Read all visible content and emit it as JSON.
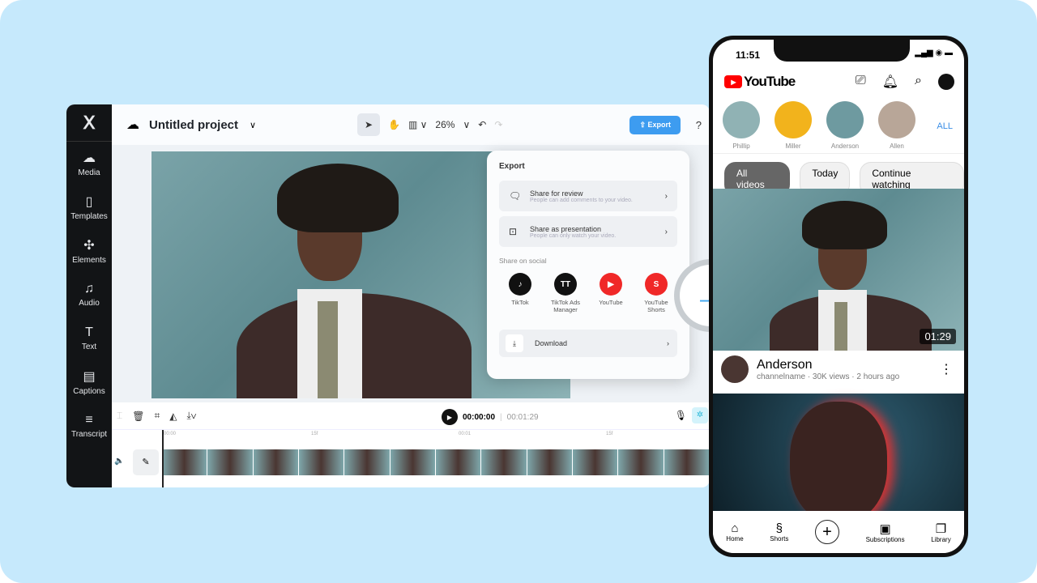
{
  "editor": {
    "sidebar": [
      {
        "icon": "cloud-upload-icon",
        "glyph": "☁",
        "label": "Media"
      },
      {
        "icon": "templates-icon",
        "glyph": "▯",
        "label": "Templates"
      },
      {
        "icon": "elements-icon",
        "glyph": "✣",
        "label": "Elements"
      },
      {
        "icon": "music-icon",
        "glyph": "♫",
        "label": "Audio"
      },
      {
        "icon": "text-icon",
        "glyph": "T",
        "label": "Text"
      },
      {
        "icon": "captions-icon",
        "glyph": "▤",
        "label": "Captions"
      },
      {
        "icon": "transcript-icon",
        "glyph": "≡",
        "label": "Transcript"
      }
    ],
    "title": "Untitled project",
    "zoom": "26%",
    "export_label": "Export",
    "export_panel": {
      "title": "Export",
      "options": [
        {
          "title": "Share for review",
          "desc": "People can add comments to your video."
        },
        {
          "title": "Share as presentation",
          "desc": "People can only watch your video."
        }
      ],
      "social_title": "Share on social",
      "social": [
        {
          "label": "TikTok",
          "color": "#111111",
          "glyph": "♪"
        },
        {
          "label": "TikTok Ads Manager",
          "color": "#111111",
          "glyph": "TT"
        },
        {
          "label": "YouTube",
          "color": "#f02828",
          "glyph": "▶"
        },
        {
          "label": "YouTube Shorts",
          "color": "#f02828",
          "glyph": "S"
        }
      ],
      "download": "Download"
    },
    "timeline": {
      "current": "00:00:00",
      "total": "00:01:29",
      "ticks": [
        "00:00",
        "15f",
        "00:01",
        "15f"
      ]
    }
  },
  "phone": {
    "time": "11:51",
    "status": "▂▄▆ ◉ ▬",
    "logo": "YouTube",
    "subscriptions": [
      {
        "name": "Phillip",
        "color": "#90b2b4"
      },
      {
        "name": "Miller",
        "color": "#f2b31c"
      },
      {
        "name": "Anderson",
        "color": "#6e9aa0"
      },
      {
        "name": "Allen",
        "color": "#b8a698"
      }
    ],
    "all": "ALL",
    "chips": [
      "All videos",
      "Today",
      "Continue watching"
    ],
    "video": {
      "duration": "01:29",
      "title": "Anderson",
      "subtitle": "channelname · 30K views · 2 hours ago"
    },
    "nav": [
      {
        "icon": "home-icon",
        "glyph": "⌂",
        "label": "Home"
      },
      {
        "icon": "shorts-icon",
        "glyph": "§",
        "label": "Shorts"
      },
      {
        "icon": "subscriptions-icon",
        "glyph": "▣",
        "label": "Subscriptions"
      },
      {
        "icon": "library-icon",
        "glyph": "❐",
        "label": "Library"
      }
    ]
  },
  "colors": {
    "accent": "#3d9cf0",
    "background": "#c6e9fc",
    "youtube_red": "#ff0000"
  }
}
